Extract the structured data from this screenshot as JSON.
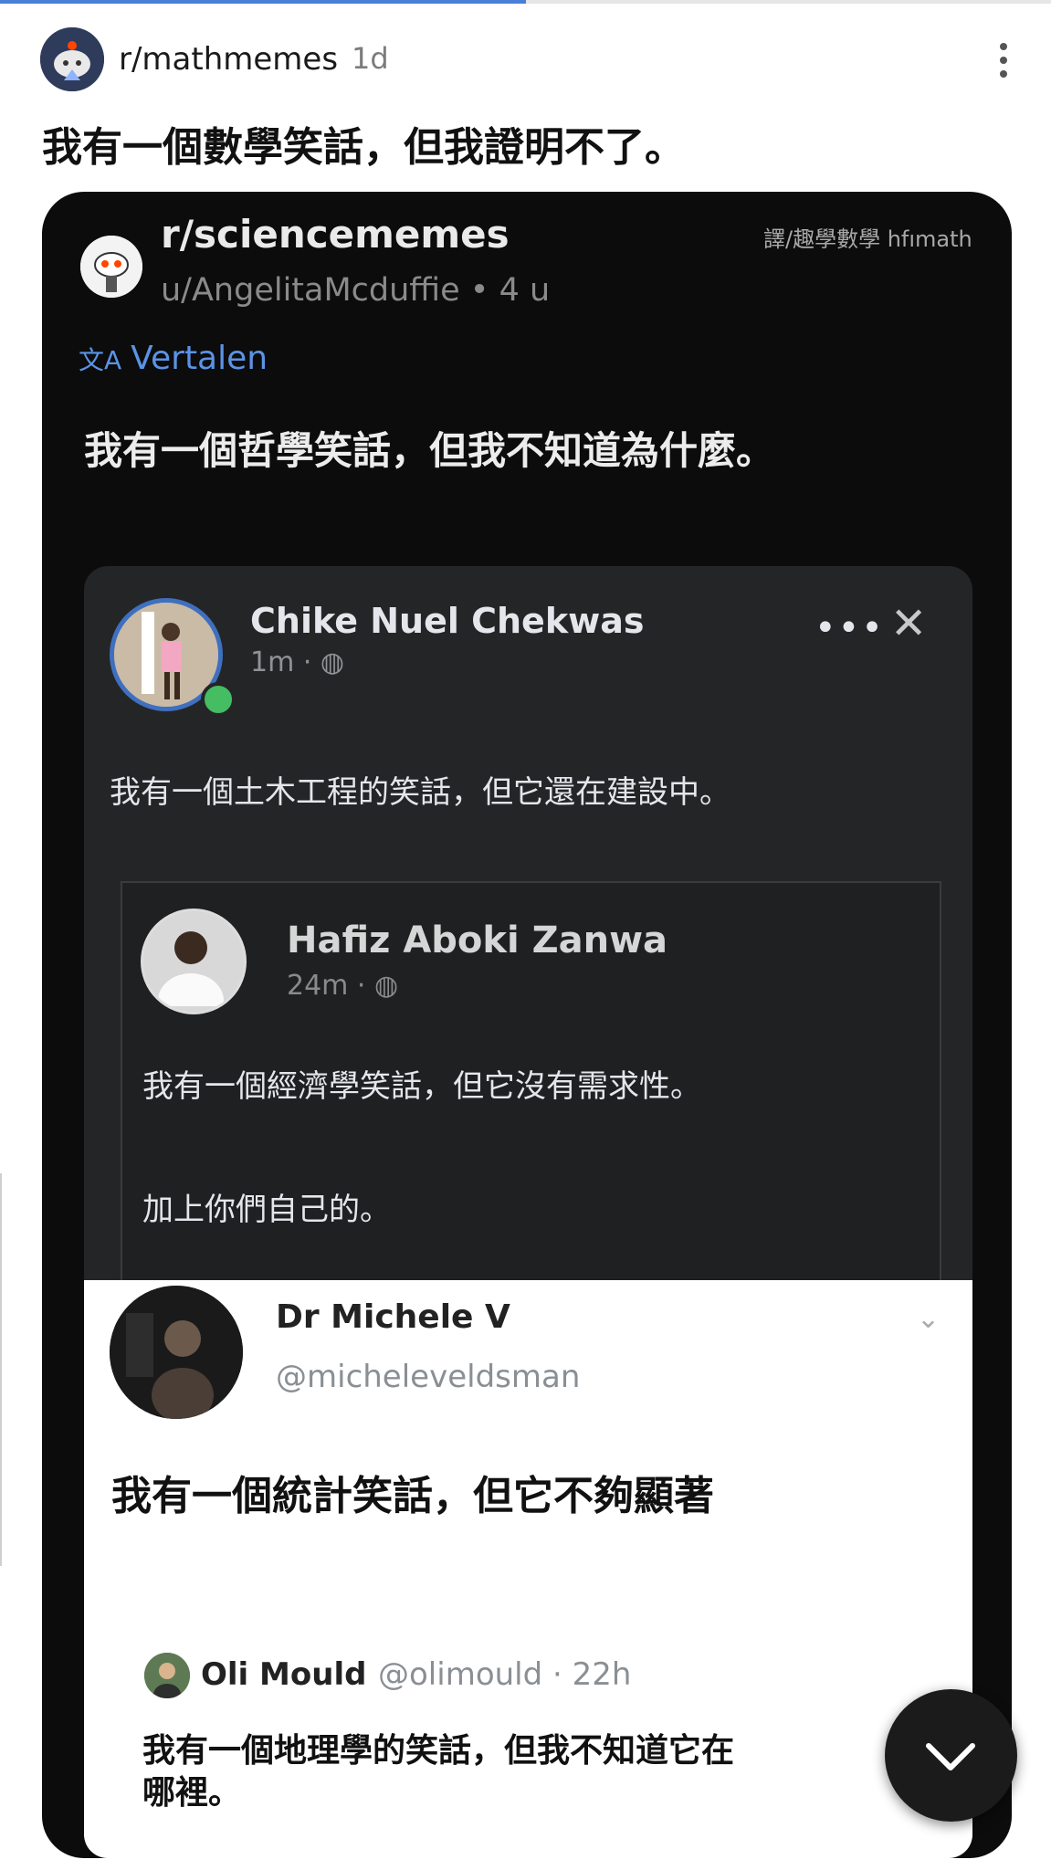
{
  "header": {
    "subreddit": "r/mathmemes",
    "age": "1d",
    "title": "我有一個數學笑話，但我證明不了。"
  },
  "screenshot": {
    "subreddit": "r/sciencememes",
    "user_line": "u/AngelitaMcduffie • 4 u",
    "watermark": "譯/趣學數學 hfımath",
    "translate_icon": "文A",
    "translate_label": "Vertalen",
    "body": "我有一個哲學笑話，但我不知道為什麼。"
  },
  "facebook_post": {
    "name": "Chike Nuel Chekwas",
    "meta": "1m · ◍",
    "more": "•••",
    "close": "✕",
    "text": "我有一個土木工程的笑話，但它還在建設中。",
    "shared": {
      "name": "Hafiz Aboki Zanwa",
      "meta": "24m · ◍",
      "text": "我有一個經濟學笑話，但它沒有需求性。",
      "text2": "加上你們自己的。"
    }
  },
  "twitter_post": {
    "name": "Dr Michele V",
    "handle": "@micheleveldsman",
    "chevron": "⌄",
    "text": "我有一個統計笑話，但它不夠顯著",
    "quote": {
      "name": "Oli Mould",
      "handle": "@olimould · 22h",
      "text_line1": "我有一個地理學的笑話，但我不知道它在",
      "text_line2": "哪裡。"
    }
  },
  "scroll_progress": 0.5,
  "colors": {
    "link_blue": "#5b93e6",
    "online_green": "#45bd62",
    "progress_blue": "#4a7fd8"
  }
}
